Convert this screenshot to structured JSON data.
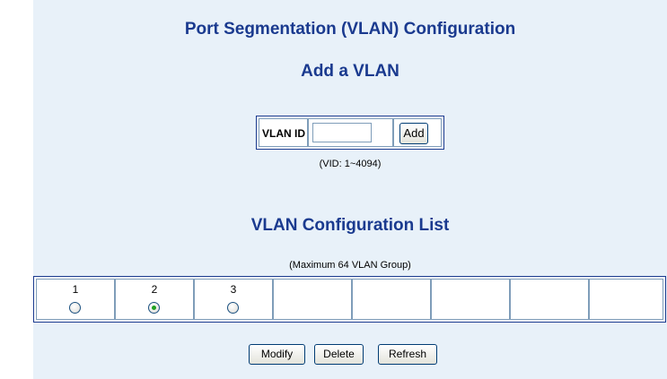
{
  "page": {
    "title": "Port Segmentation (VLAN) Configuration"
  },
  "add_section": {
    "heading": "Add a VLAN",
    "vlan_id_label": "VLAN ID",
    "vlan_id_value": "",
    "add_button": "Add",
    "hint": "(VID: 1~4094)"
  },
  "list_section": {
    "heading": "VLAN Configuration List",
    "hint": "(Maximum 64 VLAN Group)",
    "cells": [
      {
        "label": "1",
        "has_radio": true,
        "selected": false
      },
      {
        "label": "2",
        "has_radio": true,
        "selected": true
      },
      {
        "label": "3",
        "has_radio": true,
        "selected": false
      },
      {
        "label": "",
        "has_radio": false,
        "selected": false
      },
      {
        "label": "",
        "has_radio": false,
        "selected": false
      },
      {
        "label": "",
        "has_radio": false,
        "selected": false
      },
      {
        "label": "",
        "has_radio": false,
        "selected": false
      },
      {
        "label": "",
        "has_radio": false,
        "selected": false
      }
    ]
  },
  "actions": {
    "modify": "Modify",
    "delete": "Delete",
    "refresh": "Refresh"
  },
  "colors": {
    "heading": "#1a3a8f",
    "panel_bg": "#e8f1f9",
    "radio_selected": "#21a121"
  }
}
